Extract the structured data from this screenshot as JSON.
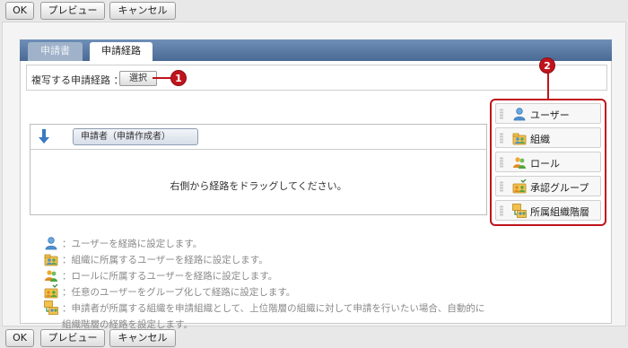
{
  "toolbar": {
    "ok_label": "OK",
    "preview_label": "プレビュー",
    "cancel_label": "キャンセル"
  },
  "tabs": [
    {
      "label": "申請書",
      "active": false
    },
    {
      "label": "申請経路",
      "active": true
    }
  ],
  "copy_route": {
    "label": "複写する申請経路 ：",
    "select_label": "選択"
  },
  "callouts": {
    "one": "1",
    "two": "2"
  },
  "route": {
    "applicant": "申請者（申請作成者）",
    "hint": "右側から経路をドラッグしてください。"
  },
  "legend": [
    {
      "icon": "user-icon",
      "text": "：ユーザーを経路に設定します。"
    },
    {
      "icon": "organization-icon",
      "text": "：組織に所属するユーザーを経路に設定します。"
    },
    {
      "icon": "role-icon",
      "text": "：ロールに所属するユーザーを経路に設定します。"
    },
    {
      "icon": "approval-group-icon",
      "text": "：任意のユーザーをグループ化して経路に設定します。"
    },
    {
      "icon": "org-hierarchy-icon",
      "text": "：申請者が所属する組織を申請組織として、上位階層の組織に対して申請を行いたい場合、自動的に"
    },
    {
      "icon": "",
      "text": "組織階層の経路を設定します。"
    }
  ],
  "palette": [
    {
      "icon": "user-icon",
      "label": "ユーザー"
    },
    {
      "icon": "organization-icon",
      "label": "組織"
    },
    {
      "icon": "role-icon",
      "label": "ロール"
    },
    {
      "icon": "approval-group-icon",
      "label": "承認グループ"
    },
    {
      "icon": "org-hierarchy-icon",
      "label": "所属組織階層"
    }
  ],
  "colors": {
    "accent": "#c0141c",
    "tab_bar": "#5a7aa5"
  }
}
